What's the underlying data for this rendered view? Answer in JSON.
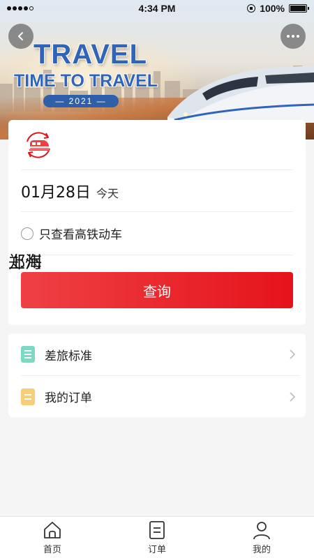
{
  "status_bar": {
    "time": "4:34 PM",
    "battery": "100%",
    "battery_level": 1.0,
    "signal_bars_filled": 4,
    "signal_bars_total": 5
  },
  "banner": {
    "title": "TRAVEL",
    "subtitle": "TIME TO TRAVEL",
    "year": "— 2021 —"
  },
  "search": {
    "from_city": "郑州",
    "to_city": "上海",
    "date": "01月28日",
    "weekday": "今天",
    "filter_label": "只查看高铁动车",
    "filter_checked": false,
    "search_button": "查询"
  },
  "menu": {
    "items": [
      {
        "label": "差旅标准",
        "icon": "document-list-icon",
        "color": "#7fd8c4"
      },
      {
        "label": "我的订单",
        "icon": "order-icon",
        "color": "#f7cf7a"
      }
    ]
  },
  "tabs": [
    {
      "label": "首页",
      "icon": "home-icon"
    },
    {
      "label": "订单",
      "icon": "order-list-icon"
    },
    {
      "label": "我的",
      "icon": "user-icon"
    }
  ],
  "colors": {
    "accent_red": "#e5131b",
    "banner_blue": "#2f64b8"
  }
}
